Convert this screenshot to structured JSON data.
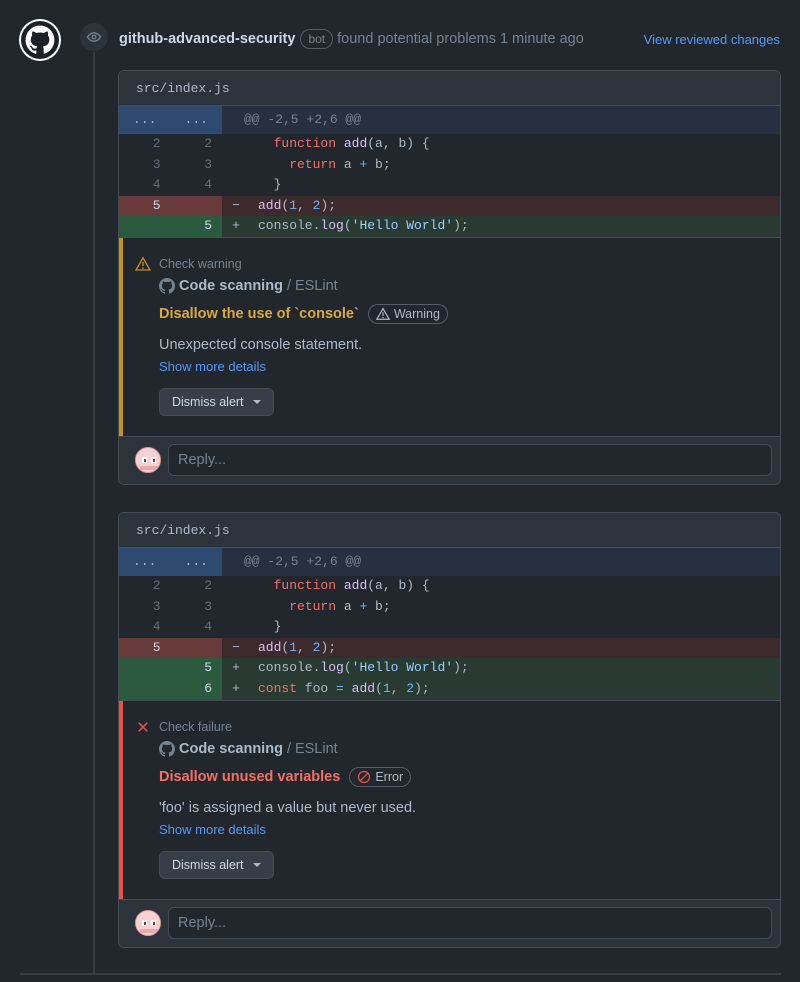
{
  "header": {
    "author": "github-advanced-security",
    "bot_badge": "bot",
    "action": "found potential problems 1 minute ago",
    "view_link": "View reviewed changes"
  },
  "threads": [
    {
      "file": "src/index.js",
      "hunk": {
        "left": "...",
        "right": "...",
        "header": "@@ -2,5 +2,6 @@"
      },
      "lines": [
        {
          "type": "ctx",
          "old": "2",
          "new": "2",
          "sign": "",
          "code": "  function add(a, b) {"
        },
        {
          "type": "ctx",
          "old": "3",
          "new": "3",
          "sign": "",
          "code": "    return a + b;"
        },
        {
          "type": "ctx",
          "old": "4",
          "new": "4",
          "sign": "",
          "code": "  }"
        },
        {
          "type": "del",
          "old": "5",
          "new": "",
          "sign": "−",
          "code": "add(1, 2);"
        },
        {
          "type": "add",
          "old": "",
          "new": "5",
          "sign": "+",
          "code": "console.log('Hello World');"
        }
      ],
      "alert": {
        "kind": "warning",
        "check_label": "Check warning",
        "tool": "Code scanning",
        "tool_sub": "ESLint",
        "rule": "Disallow the use of `console`",
        "severity": "Warning",
        "message": "Unexpected console statement.",
        "details_link": "Show more details",
        "dismiss_label": "Dismiss alert"
      },
      "reply_placeholder": "Reply..."
    },
    {
      "file": "src/index.js",
      "hunk": {
        "left": "...",
        "right": "...",
        "header": "@@ -2,5 +2,6 @@"
      },
      "lines": [
        {
          "type": "ctx",
          "old": "2",
          "new": "2",
          "sign": "",
          "code": "  function add(a, b) {"
        },
        {
          "type": "ctx",
          "old": "3",
          "new": "3",
          "sign": "",
          "code": "    return a + b;"
        },
        {
          "type": "ctx",
          "old": "4",
          "new": "4",
          "sign": "",
          "code": "  }"
        },
        {
          "type": "del",
          "old": "5",
          "new": "",
          "sign": "−",
          "code": "add(1, 2);"
        },
        {
          "type": "add",
          "old": "",
          "new": "5",
          "sign": "+",
          "code": "console.log('Hello World');"
        },
        {
          "type": "add",
          "old": "",
          "new": "6",
          "sign": "+",
          "code": "const foo = add(1, 2);"
        }
      ],
      "alert": {
        "kind": "failure",
        "check_label": "Check failure",
        "tool": "Code scanning",
        "tool_sub": "ESLint",
        "rule": "Disallow unused variables",
        "severity": "Error",
        "message": "'foo' is assigned a value but never used.",
        "details_link": "Show more details",
        "dismiss_label": "Dismiss alert"
      },
      "reply_placeholder": "Reply..."
    }
  ],
  "colors": {
    "background": "#22272e",
    "link": "#539bf5",
    "warning": "#c69026",
    "failure": "#e5534b",
    "deleted_line": "#3d2a2d",
    "added_line": "#293a33"
  },
  "icons": {
    "avatar": "github-octocat-icon",
    "event": "eye-icon",
    "warning": "alert-triangle-icon",
    "failure": "x-icon",
    "tool": "github-mark-icon",
    "error_badge": "stop-icon",
    "reply_avatar": "user-avatar"
  }
}
